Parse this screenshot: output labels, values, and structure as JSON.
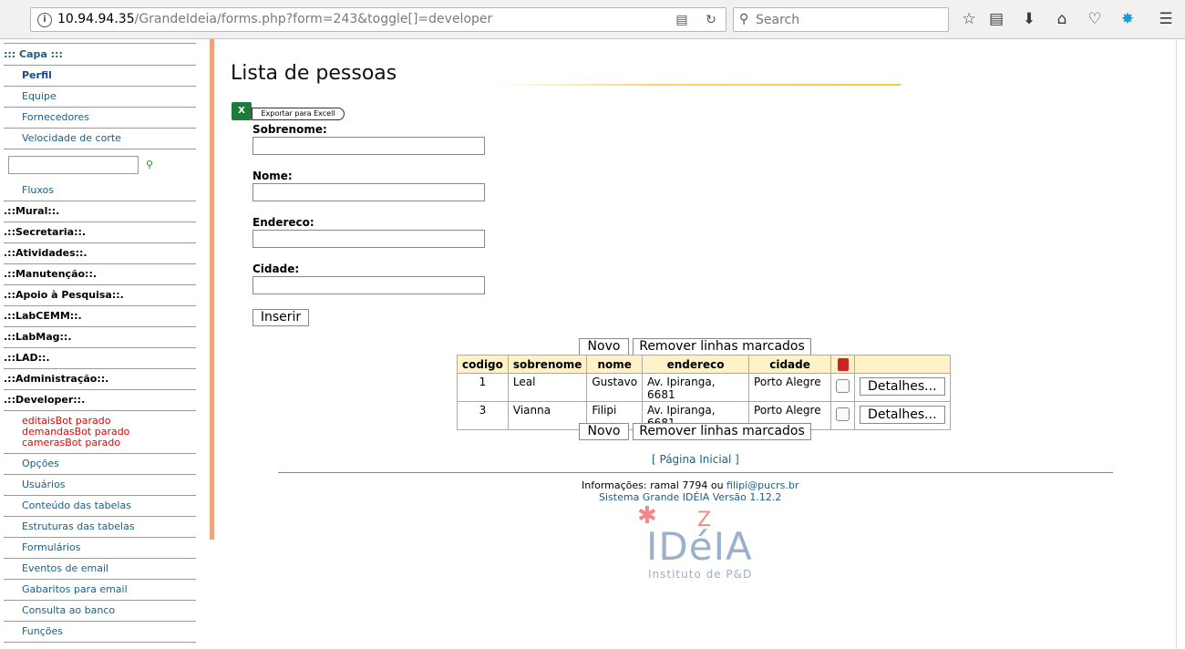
{
  "browser": {
    "url_host": "10.94.94.35",
    "url_path": "/GrandeIdeia/forms.php?form=243&toggle[]=developer",
    "search_placeholder": "Search",
    "icons": [
      "info-icon",
      "reader-icon",
      "reload-icon",
      "search-icon",
      "bookmark-star-icon",
      "reading-list-icon",
      "download-icon",
      "home-icon",
      "pocket-icon",
      "extension-icon",
      "menu-icon"
    ]
  },
  "sidebar": {
    "capa": "::: Capa :::",
    "perfil": "Perfil",
    "equipe": "Equipe",
    "fornecedores": "Fornecedores",
    "velocidade": "Velocidade de corte",
    "fluxos": "Fluxos",
    "mural": ".::Mural::.",
    "secretaria": ".::Secretaria::.",
    "atividades": ".::Atividades::.",
    "manutencao": ".::Manutenção::.",
    "apoio": ".::Apoio à Pesquisa::.",
    "labcemm": ".::LabCEMM::.",
    "labmag": ".::LabMag::.",
    "lad": ".::LAD::.",
    "administracao": ".::Administração::.",
    "developer": ".::Developer::.",
    "bot1": "editaisBot parado",
    "bot2": "demandasBot parado",
    "bot3": "camerasBot parado",
    "opcoes": "Opções",
    "usuarios": "Usuários",
    "conteudo": "Conteúdo das tabelas",
    "estruturas": "Estruturas das tabelas",
    "formularios": "Formulários",
    "eventos": "Eventos de email",
    "gabaritos": "Gabaritos para email",
    "consulta": "Consulta ao banco",
    "funcoes": "Funções"
  },
  "main": {
    "title": "Lista de pessoas",
    "excel_icon": "X",
    "excel_label": "Exportar para Excell",
    "labels": {
      "sobrenome": "Sobrenome:",
      "nome": "Nome:",
      "endereco": "Endereco:",
      "cidade": "Cidade:"
    },
    "inserir": "Inserir",
    "novo": "Novo",
    "remover": "Remover linhas marcados",
    "columns": [
      "codigo",
      "sobrenome",
      "nome",
      "endereco",
      "cidade"
    ],
    "rows": [
      {
        "codigo": "1",
        "sobrenome": "Leal",
        "nome": "Gustavo",
        "endereco": "Av. Ipiranga, 6681",
        "cidade": "Porto Alegre"
      },
      {
        "codigo": "3",
        "sobrenome": "Vianna",
        "nome": "Filipi",
        "endereco": "Av. Ipiranga, 6681",
        "cidade": "Porto Alegre"
      }
    ],
    "detalhes": "Detalhes...",
    "home_link": "[ Página Inicial ]",
    "info_prefix": "Informações: ramal 7794 ou ",
    "info_email": "filipi@pucrs.br",
    "version": "Sistema Grande IDÉIA Versão 1.12.2",
    "logo_word": "IDéIA",
    "logo_sub": "Instituto de P&D"
  }
}
